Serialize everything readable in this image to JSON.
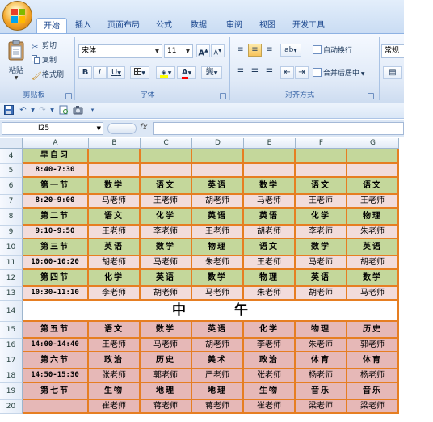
{
  "tabs": [
    "开始",
    "插入",
    "页面布局",
    "公式",
    "数据",
    "审阅",
    "视图",
    "开发工具"
  ],
  "active_tab": "开始",
  "ribbon": {
    "clipboard": {
      "paste": "粘贴",
      "cut": "剪切",
      "copy": "复制",
      "format_painter": "格式刷",
      "label": "剪贴板"
    },
    "font": {
      "font_name": "宋体",
      "font_size": "11",
      "grow": "A",
      "shrink": "A",
      "bold": "B",
      "italic": "I",
      "underline": "U",
      "phonetic": "變",
      "label": "字体"
    },
    "alignment": {
      "wrap_text": "自动换行",
      "merge_center": "合并后居中",
      "label": "对齐方式"
    },
    "number": {
      "format": "常规"
    }
  },
  "formula_bar": {
    "name_box": "I25",
    "fx": "fx",
    "value": ""
  },
  "colors": {
    "orange_border": "#e67e22",
    "green_fill": "#c4d79b",
    "pink_fill": "#f2dcdb",
    "salmon_fill": "#e6b8b7",
    "white_fill": "#ffffff"
  },
  "grid": {
    "columns": [
      "A",
      "B",
      "C",
      "D",
      "E",
      "F",
      "G"
    ],
    "rows": [
      {
        "num": "4",
        "fill": "green",
        "style": "hand",
        "cells": [
          "早自习",
          "",
          "",
          "",
          "",
          "",
          ""
        ]
      },
      {
        "num": "5",
        "fill": "pink",
        "style": "time",
        "cells": [
          "8:40-7:30",
          "",
          "",
          "",
          "",
          "",
          ""
        ]
      },
      {
        "num": "6",
        "fill": "green",
        "style": "hand",
        "cells": [
          "第一节",
          "数学",
          "语文",
          "英语",
          "数学",
          "语文",
          "语文"
        ]
      },
      {
        "num": "7",
        "fill": "pink",
        "style": "norm",
        "cells": [
          "8:20-9:00",
          "马老师",
          "王老师",
          "胡老师",
          "马老师",
          "王老师",
          "王老师"
        ]
      },
      {
        "num": "8",
        "fill": "green",
        "style": "hand",
        "cells": [
          "第二节",
          "语文",
          "化学",
          "英语",
          "英语",
          "化学",
          "物理"
        ]
      },
      {
        "num": "9",
        "fill": "pink",
        "style": "norm",
        "cells": [
          "9:10-9:50",
          "王老师",
          "李老师",
          "王老师",
          "胡老师",
          "李老师",
          "朱老师"
        ]
      },
      {
        "num": "10",
        "fill": "green",
        "style": "hand",
        "cells": [
          "第三节",
          "英语",
          "数学",
          "物理",
          "语文",
          "数学",
          "英语"
        ]
      },
      {
        "num": "11",
        "fill": "pink",
        "style": "norm",
        "cells": [
          "10:00-10:20",
          "胡老师",
          "马老师",
          "朱老师",
          "王老师",
          "马老师",
          "胡老师"
        ]
      },
      {
        "num": "12",
        "fill": "green",
        "style": "hand",
        "cells": [
          "第四节",
          "化学",
          "英语",
          "数学",
          "物理",
          "英语",
          "数学"
        ]
      },
      {
        "num": "13",
        "fill": "pink",
        "style": "norm",
        "cells": [
          "10:30-11:10",
          "李老师",
          "胡老师",
          "马老师",
          "朱老师",
          "胡老师",
          "马老师"
        ]
      },
      {
        "num": "14",
        "fill": "white",
        "style": "noon",
        "cells": [
          "中午"
        ]
      },
      {
        "num": "15",
        "fill": "salmon",
        "style": "hand",
        "cells": [
          "第五节",
          "语文",
          "数学",
          "英语",
          "化学",
          "物理",
          "历史"
        ]
      },
      {
        "num": "16",
        "fill": "salmon",
        "style": "norm",
        "cells": [
          "14:00-14:40",
          "王老师",
          "马老师",
          "胡老师",
          "李老师",
          "朱老师",
          "郭老师"
        ]
      },
      {
        "num": "17",
        "fill": "salmon",
        "style": "hand",
        "cells": [
          "第六节",
          "政治",
          "历史",
          "美术",
          "政治",
          "体育",
          "体育"
        ]
      },
      {
        "num": "18",
        "fill": "salmon",
        "style": "norm",
        "cells": [
          "14:50-15:30",
          "张老师",
          "郭老师",
          "严老师",
          "张老师",
          "杨老师",
          "杨老师"
        ]
      },
      {
        "num": "19",
        "fill": "salmon",
        "style": "hand",
        "cells": [
          "第七节",
          "生物",
          "地理",
          "地理",
          "生物",
          "音乐",
          "音乐"
        ]
      },
      {
        "num": "20",
        "fill": "salmon",
        "style": "norm",
        "cells": [
          "",
          "崔老师",
          "蒋老师",
          "蒋老师",
          "崔老师",
          "梁老师",
          "梁老师"
        ]
      }
    ]
  }
}
